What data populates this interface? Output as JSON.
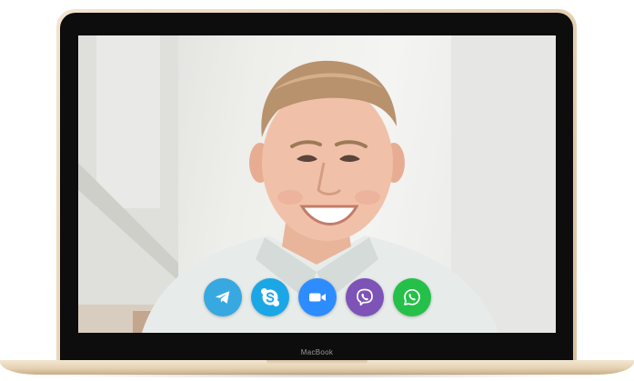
{
  "laptop": {
    "brand_label": "MacBook"
  },
  "call_bar": {
    "buttons": [
      {
        "name": "telegram",
        "icon": "telegram-icon",
        "color": "#37a8e0"
      },
      {
        "name": "skype",
        "icon": "skype-icon",
        "color": "#1ba7e6"
      },
      {
        "name": "zoom",
        "icon": "zoom-video-icon",
        "color": "#2d8cff"
      },
      {
        "name": "viber",
        "icon": "viber-icon",
        "color": "#7d53b8"
      },
      {
        "name": "whatsapp",
        "icon": "whatsapp-icon",
        "color": "#25c049"
      }
    ]
  },
  "colors": {
    "lid_gold": "#e9d5b8",
    "bezel": "#0d0d0d",
    "screen_bg": "#eeeeeb"
  }
}
